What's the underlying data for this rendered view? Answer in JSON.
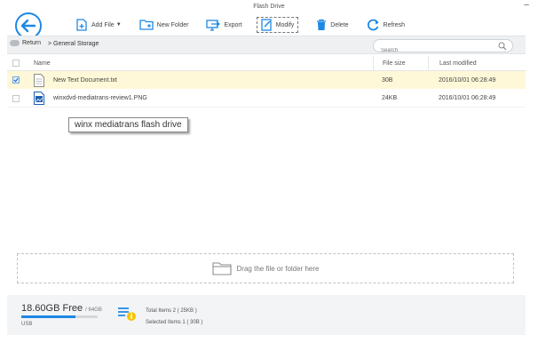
{
  "window": {
    "title": "Flash Drive",
    "minimize": "–"
  },
  "toolbar": {
    "add_file": "Add File",
    "new_folder": "New Folder",
    "export": "Export",
    "modify": "Modify",
    "delete": "Delete",
    "refresh": "Refresh"
  },
  "address": {
    "return_label": "Return",
    "breadcrumb": "> General Storage",
    "search_placeholder": "Search"
  },
  "table": {
    "headers": {
      "name": "Name",
      "size": "File size",
      "date": "Last modified"
    },
    "rows": [
      {
        "name": "New Text Document.txt",
        "size": "30B",
        "date": "2016/10/01 06:28:49",
        "checked": true,
        "selected": true,
        "icon": "text-file-icon"
      },
      {
        "name": "winxdvd-mediatrans-review1.PNG",
        "size": "24KB",
        "date": "2016/10/01 06:28:49",
        "checked": false,
        "selected": false,
        "icon": "image-file-icon"
      }
    ]
  },
  "tooltip": {
    "text": "winx mediatrans flash drive"
  },
  "drop_zone": {
    "label": "Drag the file or folder here"
  },
  "status": {
    "free": "18.60GB Free",
    "total": "/ 64GB",
    "device": "USB",
    "used_fraction": 0.71,
    "total_items": "Total Items 2 ( 25KB )",
    "selected_items": "Selected Items 1 ( 30B )"
  },
  "colors": {
    "accent": "#1e88e5",
    "selected_row": "#fff8d8"
  }
}
